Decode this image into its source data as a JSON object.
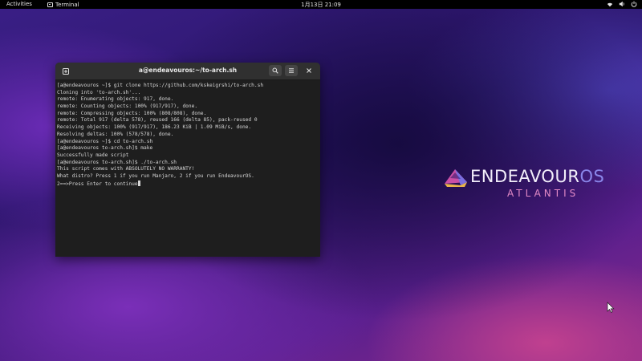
{
  "topbar": {
    "activities_label": "Activities",
    "app_name": "Terminal",
    "clock": "1月13日 21:09",
    "tray_icons": [
      "network-icon",
      "volume-icon",
      "power-icon"
    ]
  },
  "wallpaper": {
    "logo_text_main": "ENDEAVOUR",
    "logo_text_os": "OS",
    "logo_subtitle": "ATLANTIS",
    "colors": {
      "logo_main": "#f2eefa",
      "logo_os": "#8a86ea",
      "logo_sub": "#e28ac6"
    }
  },
  "terminal": {
    "title": "a@endeavouros:~/to-arch.sh",
    "lines": [
      "[a@endeavouros ~]$ git clone https://github.com/kskeigrshi/to-arch.sh",
      "Cloning into 'to-arch.sh'...",
      "remote: Enumerating objects: 917, done.",
      "remote: Counting objects: 100% (917/917), done.",
      "remote: Compressing objects: 100% (808/808), done.",
      "remote: Total 917 (delta 578), reused 166 (delta 85), pack-reused 0",
      "Receiving objects: 100% (917/917), 186.23 KiB | 1.09 MiB/s, done.",
      "Resolving deltas: 100% (578/578), done.",
      "[a@endeavouros ~]$ cd to-arch.sh",
      "[a@endeavouros to-arch.sh]$ make",
      "Successfully made script",
      "[a@endeavouros to-arch.sh]$ ./to-arch.sh",
      "This script comes with ABSOLUTELY NO WARRANTY!",
      "What distro? Press 1 if you run Manjaro, 2 if you run EndeavourOS.",
      "2==>Press Enter to continue"
    ]
  }
}
